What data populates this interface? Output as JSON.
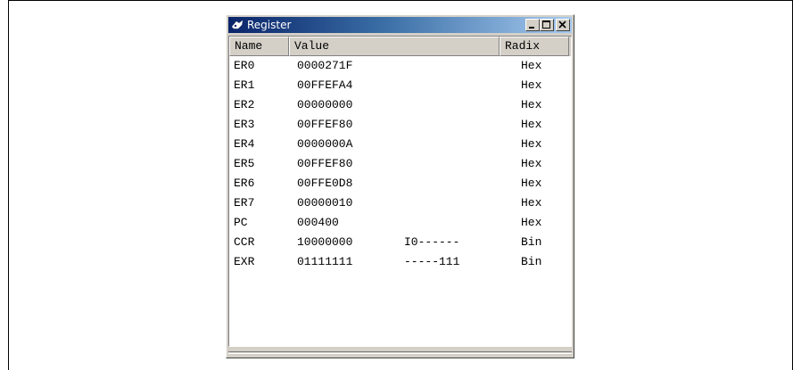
{
  "window": {
    "title": "Register",
    "minimize_label": "_",
    "maximize_label": "□",
    "close_label": "✕"
  },
  "columns": {
    "name": "Name",
    "value": "Value",
    "radix": "Radix"
  },
  "rows": [
    {
      "name": "ER0",
      "value": "0000271F",
      "flags": "",
      "radix": "Hex"
    },
    {
      "name": "ER1",
      "value": "00FFEFA4",
      "flags": "",
      "radix": "Hex"
    },
    {
      "name": "ER2",
      "value": "00000000",
      "flags": "",
      "radix": "Hex"
    },
    {
      "name": "ER3",
      "value": "00FFEF80",
      "flags": "",
      "radix": "Hex"
    },
    {
      "name": "ER4",
      "value": "0000000A",
      "flags": "",
      "radix": "Hex"
    },
    {
      "name": "ER5",
      "value": "00FFEF80",
      "flags": "",
      "radix": "Hex"
    },
    {
      "name": "ER6",
      "value": "00FFE0D8",
      "flags": "",
      "radix": "Hex"
    },
    {
      "name": "ER7",
      "value": "00000010",
      "flags": "",
      "radix": "Hex"
    },
    {
      "name": "PC",
      "value": "000400",
      "flags": "",
      "radix": "Hex"
    },
    {
      "name": "CCR",
      "value": "10000000",
      "flags": "I0------",
      "radix": "Bin"
    },
    {
      "name": "EXR",
      "value": "01111111",
      "flags": "-----111",
      "radix": "Bin"
    }
  ],
  "icons": {
    "title": "register-window-icon"
  },
  "colors": {
    "title_start": "#0a246a",
    "title_end": "#a6caf0",
    "face": "#d4d0c8"
  }
}
